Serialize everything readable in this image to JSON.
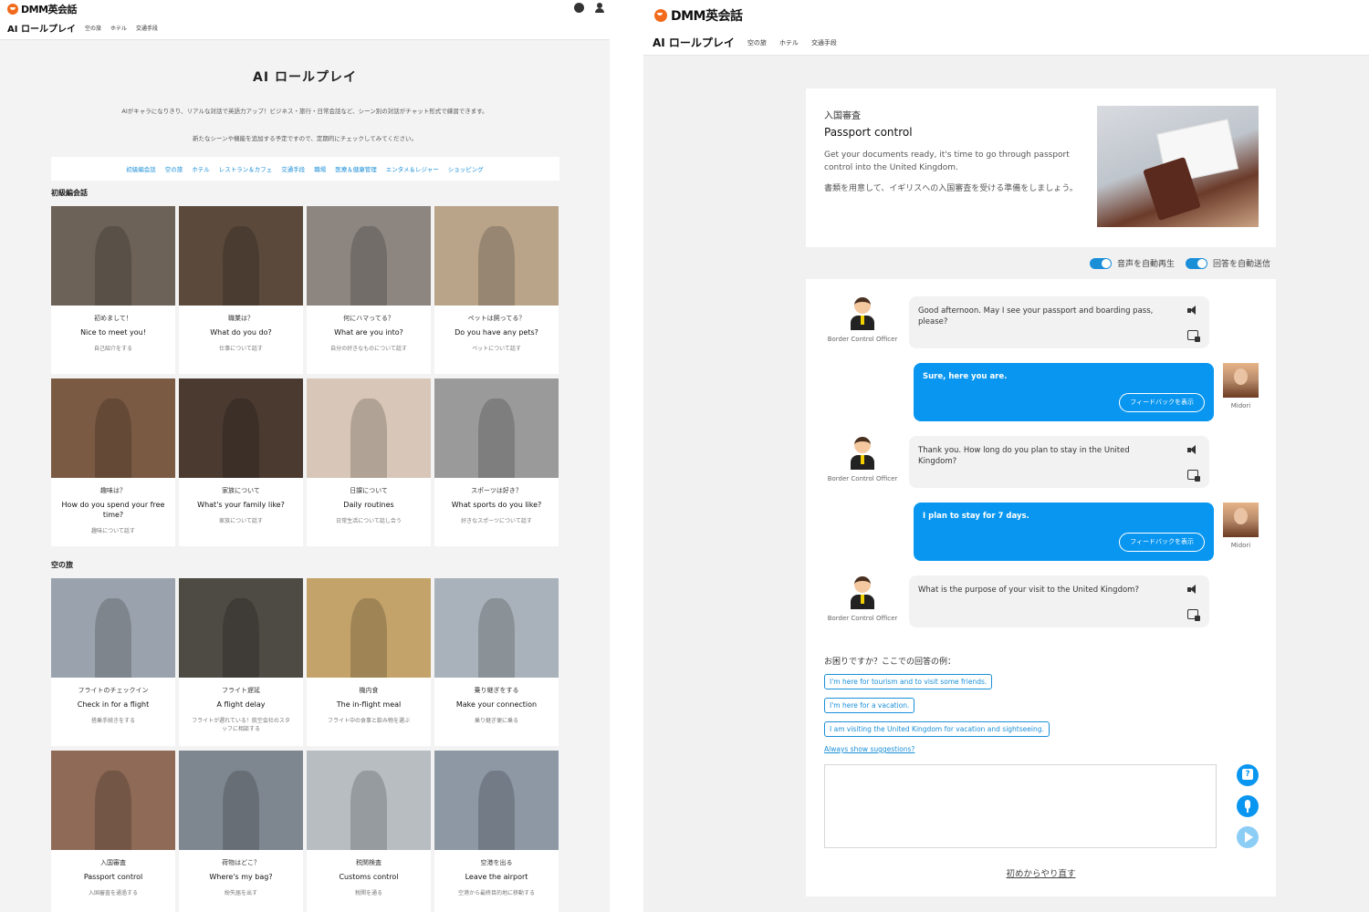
{
  "left": {
    "logo_text": "DMM英会話",
    "subnav": {
      "brand": "AI ロールプレイ",
      "links": [
        "空の旅",
        "ホテル",
        "交通手段"
      ]
    },
    "page_title": "AI ロールプレイ",
    "desc1": "AIがキャラになりきり、リアルな対話で英語力アップ！ビジネス・旅行・日常会話など、シーン別の対話がチャット形式で練習できます。",
    "desc2": "新たなシーンや機能を追加する予定ですので、定期的にチェックしてみてください。",
    "categories": [
      "初級編会話",
      "空の旅",
      "ホテル",
      "レストラン＆カフェ",
      "交通手段",
      "職場",
      "医療＆健康管理",
      "エンタメ＆レジャー",
      "ショッピング"
    ],
    "sections": [
      {
        "title": "初級編会話",
        "cards": [
          {
            "jp": "初めまして！",
            "en": "Nice to meet you!",
            "sub": "自己紹介をする",
            "color": "#6d6258"
          },
          {
            "jp": "職業は？",
            "en": "What do you do?",
            "sub": "仕事について話す",
            "color": "#5b4a3c"
          },
          {
            "jp": "何にハマってる？",
            "en": "What are you into?",
            "sub": "自分の好きなものについて話す",
            "color": "#8c8580"
          },
          {
            "jp": "ペットは飼ってる？",
            "en": "Do you have any pets?",
            "sub": "ペットについて話す",
            "color": "#b9a48a"
          },
          {
            "jp": "趣味は？",
            "en": "How do you spend your free time?",
            "sub": "趣味について話す",
            "color": "#7a5a43"
          },
          {
            "jp": "家族について",
            "en": "What's your family like?",
            "sub": "家族について話す",
            "color": "#4a3a30"
          },
          {
            "jp": "日課について",
            "en": "Daily routines",
            "sub": "日常生活について話し合う",
            "color": "#d8c6b8"
          },
          {
            "jp": "スポーツは好き？",
            "en": "What sports do you like?",
            "sub": "好きなスポーツについて話す",
            "color": "#9a9a9a"
          }
        ]
      },
      {
        "title": "空の旅",
        "cards": [
          {
            "jp": "フライトのチェックイン",
            "en": "Check in for a flight",
            "sub": "搭乗手続きをする",
            "color": "#9aa3ad"
          },
          {
            "jp": "フライト遅延",
            "en": "A flight delay",
            "sub": "フライトが遅れている！航空会社のスタッフに相談する",
            "color": "#4e4a44"
          },
          {
            "jp": "機内食",
            "en": "The in-flight meal",
            "sub": "フライト中の食事と飲み物を選ぶ",
            "color": "#c3a36a"
          },
          {
            "jp": "乗り継ぎをする",
            "en": "Make your connection",
            "sub": "乗り継ぎ便に乗る",
            "color": "#a9b2ba"
          },
          {
            "jp": "入国審査",
            "en": "Passport control",
            "sub": "入国審査を通過する",
            "color": "#8e6a57"
          },
          {
            "jp": "荷物はどこ？",
            "en": "Where's my bag?",
            "sub": "紛失届を出す",
            "color": "#7e8790"
          },
          {
            "jp": "税関検査",
            "en": "Customs control",
            "sub": "税関を通る",
            "color": "#b8bdc2"
          },
          {
            "jp": "空港を出る",
            "en": "Leave the airport",
            "sub": "空港から最終目的地に移動する",
            "color": "#8d98a4"
          }
        ]
      }
    ]
  },
  "right": {
    "logo_text": "DMM英会話",
    "subnav": {
      "brand": "AI ロールプレイ",
      "links": [
        "空の旅",
        "ホテル",
        "交通手段"
      ]
    },
    "scenario": {
      "jp_title": "入国審査",
      "en_title": "Passport control",
      "en_desc": "Get your documents ready, it's time to go through passport control into the United Kingdom.",
      "jp_desc": "書類を用意して、イギリスへの入国審査を受ける準備をしましょう。"
    },
    "toggles": {
      "autoplay_label": "音声を自動再生",
      "autosend_label": "回答を自動送信"
    },
    "bot_name": "Border Control Officer",
    "user_name": "Midori",
    "feedback_label": "フィードバックを表示",
    "messages": {
      "bot1": "Good afternoon. May I see your passport and boarding pass, please?",
      "user1": "Sure, here you are.",
      "bot2": "Thank you. How long do you plan to stay in the United Kingdom?",
      "user2": "I plan to stay for 7 days.",
      "bot3": "What is the purpose of your visit to the United Kingdom?"
    },
    "help_title": "お困りですか？ここでの回答の例：",
    "suggestions": [
      "I'm here for tourism and to visit some friends.",
      "I'm here for a vacation.",
      "I am visiting the United Kingdom for vacation and sightseeing."
    ],
    "always_show": "Always show suggestions?",
    "reply_placeholder": "",
    "restart_label": "初めからやり直す"
  }
}
